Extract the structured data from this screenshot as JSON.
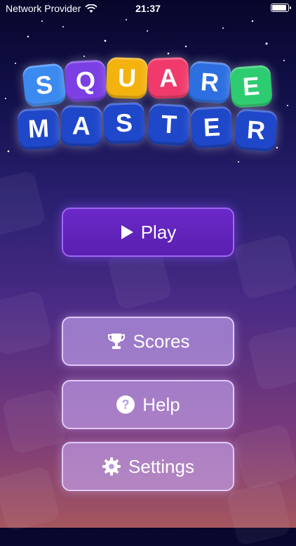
{
  "status_bar": {
    "carrier": "Network Provider",
    "time": "21:37"
  },
  "logo": {
    "line1": [
      "S",
      "Q",
      "U",
      "A",
      "R",
      "E"
    ],
    "line2": [
      "M",
      "A",
      "S",
      "T",
      "E",
      "R"
    ]
  },
  "menu": {
    "play": "Play",
    "scores": "Scores",
    "help": "Help",
    "settings": "Settings"
  },
  "icons": {
    "play": "play-triangle-icon",
    "scores": "trophy-icon",
    "help": "question-circle-icon",
    "settings": "gear-icon"
  },
  "colors": {
    "tile_blue": "#2d6fe0",
    "tile_yellow": "#f3b20e",
    "tile_pink": "#f03a6b",
    "tile_green": "#2ecc71",
    "tile_darkblue": "#1f47c9",
    "play_button": "#5f24bd"
  }
}
